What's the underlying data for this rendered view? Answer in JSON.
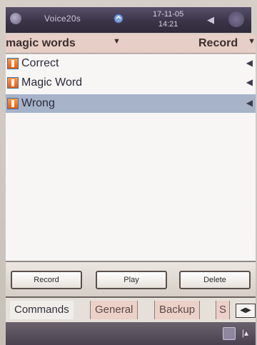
{
  "status": {
    "carrier": "Voice20s",
    "date": "17-11-05",
    "time": "14:21"
  },
  "header": {
    "category": "magic words",
    "category_arrow": "▼",
    "sort": "Record",
    "sort_arrow": "▼"
  },
  "list": {
    "items": [
      {
        "label": "Correct",
        "speaker": "◀"
      },
      {
        "label": "Magic Word",
        "speaker": "◀"
      },
      {
        "label": "Wrong",
        "speaker": "◀"
      }
    ],
    "selected_index": 2
  },
  "buttons": {
    "record": "Record",
    "play": "Play",
    "delete": "Delete"
  },
  "tabs": {
    "commands": "Commands",
    "general": "General",
    "backup": "Backup",
    "partial": "S",
    "scroll": "◀▶"
  },
  "taskbar": {
    "caret": "|▴"
  }
}
